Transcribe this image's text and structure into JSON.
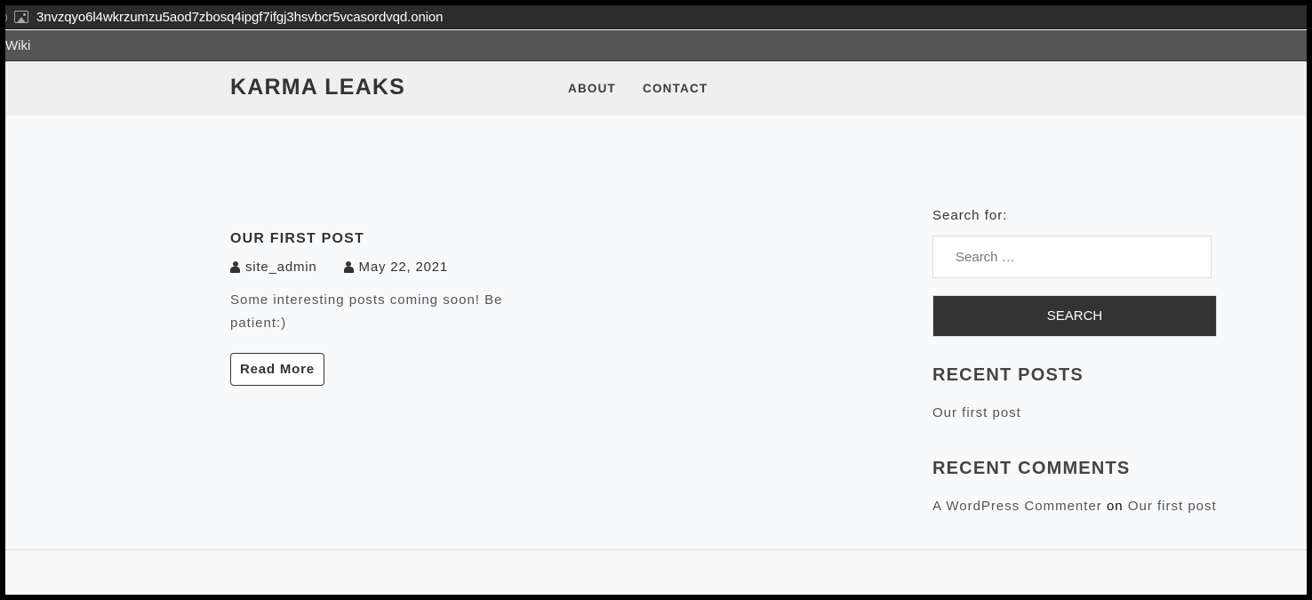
{
  "browser": {
    "url": "3nvzqyo6l4wkrzumzu5aod7zbosq4ipgf7ifgj3hsvbcr5vcasordvqd.onion",
    "menu": [
      "Wiki"
    ]
  },
  "header": {
    "site_title": "KARMA LEAKS",
    "nav": [
      {
        "label": "ABOUT"
      },
      {
        "label": "CONTACT"
      }
    ]
  },
  "post": {
    "title": "OUR FIRST POST",
    "author": "site_admin",
    "date": "May 22, 2021",
    "excerpt": "Some interesting posts coming soon! Be patient:)",
    "read_more_label": "Read More"
  },
  "sidebar": {
    "search_label": "Search for:",
    "search_placeholder": "Search …",
    "search_value": "",
    "search_button": "Search",
    "recent_posts": {
      "title": "Recent Posts",
      "items": [
        "Our first post"
      ]
    },
    "recent_comments": {
      "title": "Recent Comments",
      "items": [
        {
          "author": "A WordPress Commenter",
          "connector": "on",
          "post": "Our first post"
        }
      ]
    }
  }
}
